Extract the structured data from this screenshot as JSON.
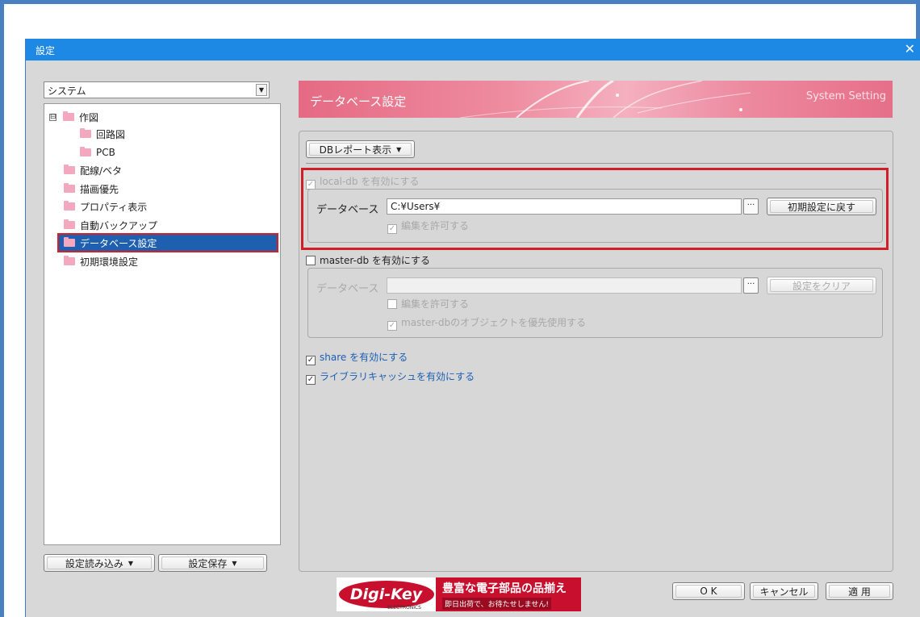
{
  "window": {
    "title": "設定",
    "close_glyph": "✕"
  },
  "left": {
    "category_combo": {
      "value": "システム",
      "arrow": "▼"
    },
    "tree": [
      {
        "label": "作図",
        "expander": "⊟"
      },
      {
        "label": "回路図"
      },
      {
        "label": "PCB"
      },
      {
        "label": "配線/ベタ"
      },
      {
        "label": "描画優先"
      },
      {
        "label": "プロパティ表示"
      },
      {
        "label": "自動バックアップ"
      },
      {
        "label": "データベース設定",
        "selected": true
      },
      {
        "label": "初期環境設定"
      }
    ],
    "load_button": "設定読み込み",
    "save_button": "設定保存",
    "dropdown_arrow": "▼"
  },
  "banner": {
    "title": "データベース設定",
    "subtitle": "System Setting"
  },
  "main": {
    "db_report_button": "DBレポート表示",
    "local_db": {
      "checkbox_label": "local-db を有効にする",
      "checked": true,
      "database_label": "データベース",
      "database_value": "C:¥Users¥",
      "browse_glyph": "···",
      "reset_button": "初期設定に戻す",
      "allow_edit_label": "編集を許可する",
      "allow_edit_checked": true
    },
    "master_db": {
      "checkbox_label": "master-db を有効にする",
      "checked": false,
      "database_label": "データベース",
      "database_value": "",
      "browse_glyph": "···",
      "clear_button": "設定をクリア",
      "allow_edit_label": "編集を許可する",
      "prefer_objects_label": "master-dbのオブジェクトを優先使用する"
    },
    "share_label": "share を有効にする",
    "library_cache_label": "ライブラリキャッシュを有効にする"
  },
  "footer": {
    "logo": {
      "brand": "Digi-Key",
      "brand_sub": "ELECTRONICS",
      "headline": "豊富な電子部品の品揃え",
      "tagline": "即日出荷で、お待たせしません!"
    },
    "ok_button": "O K",
    "cancel_button": "キャンセル",
    "apply_button": "適 用"
  },
  "colors": {
    "titlebar": "#1e88e5",
    "selection": "#1e5fb0",
    "highlight_border": "#d01f26",
    "banner": "#e56a83",
    "digikey_red": "#c8102e",
    "link_blue": "#1b5fb3"
  }
}
